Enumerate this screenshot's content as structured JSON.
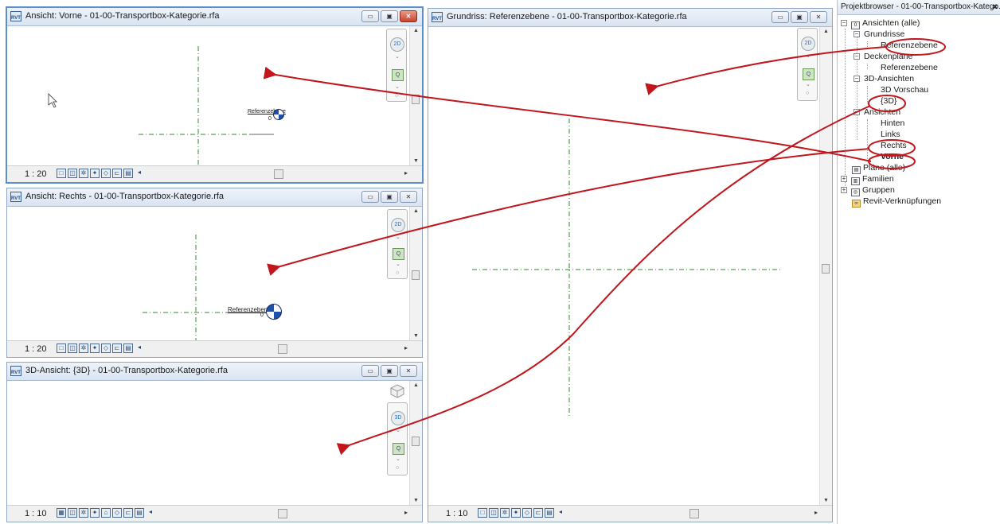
{
  "views": {
    "front": {
      "title": "Ansicht: Vorne - 01-00-Transportbox-Kategorie.rfa",
      "scale": "1 : 20",
      "ref_label": "Referenzebene",
      "ref_num": "0"
    },
    "right": {
      "title": "Ansicht: Rechts - 01-00-Transportbox-Kategorie.rfa",
      "scale": "1 : 20",
      "ref_label": "Referenzebene",
      "ref_num": "0"
    },
    "view3d": {
      "title": "3D-Ansicht: {3D} - 01-00-Transportbox-Kategorie.rfa",
      "scale": "1 : 10"
    },
    "plan": {
      "title": "Grundriss: Referenzebene - 01-00-Transportbox-Kategorie.rfa",
      "scale": "1 : 10"
    }
  },
  "project_browser": {
    "title": "Projektbrowser - 01-00-Transportbox-Katego...",
    "close": "×",
    "items": [
      {
        "label": "Ansichten (alle)"
      },
      {
        "label": "Grundrisse"
      },
      {
        "label": "Referenzebene"
      },
      {
        "label": "Deckenpläne"
      },
      {
        "label": "Referenzebene"
      },
      {
        "label": "3D-Ansichten"
      },
      {
        "label": "3D Vorschau"
      },
      {
        "label": "{3D}"
      },
      {
        "label": "Ansichten"
      },
      {
        "label": "Hinten"
      },
      {
        "label": "Links"
      },
      {
        "label": "Rechts"
      },
      {
        "label": "Vorne"
      },
      {
        "label": "Pläne (alle)"
      },
      {
        "label": "Familien"
      },
      {
        "label": "Gruppen"
      },
      {
        "label": "Revit-Verknüpfungen"
      }
    ]
  },
  "colors": {
    "accent": "#5a8fd0",
    "annotation": "#c0161c",
    "grid_line": "#2e8b2e",
    "ref_marker": "#1c4fae"
  }
}
